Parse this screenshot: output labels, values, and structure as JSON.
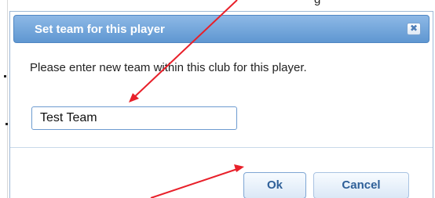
{
  "top_text_fragment": "g",
  "dialog": {
    "title": "Set team for this player",
    "close_glyph": "✖",
    "prompt": "Please enter new team within this club for this player.",
    "team_input": {
      "value": "Test Team",
      "placeholder": ""
    },
    "ok_label": "Ok",
    "cancel_label": "Cancel"
  },
  "colors": {
    "titlebar": "#6fa3da",
    "annotation_arrow": "#e8202a",
    "button_text": "#2e5f98"
  },
  "icons": {
    "close": "close-icon"
  }
}
